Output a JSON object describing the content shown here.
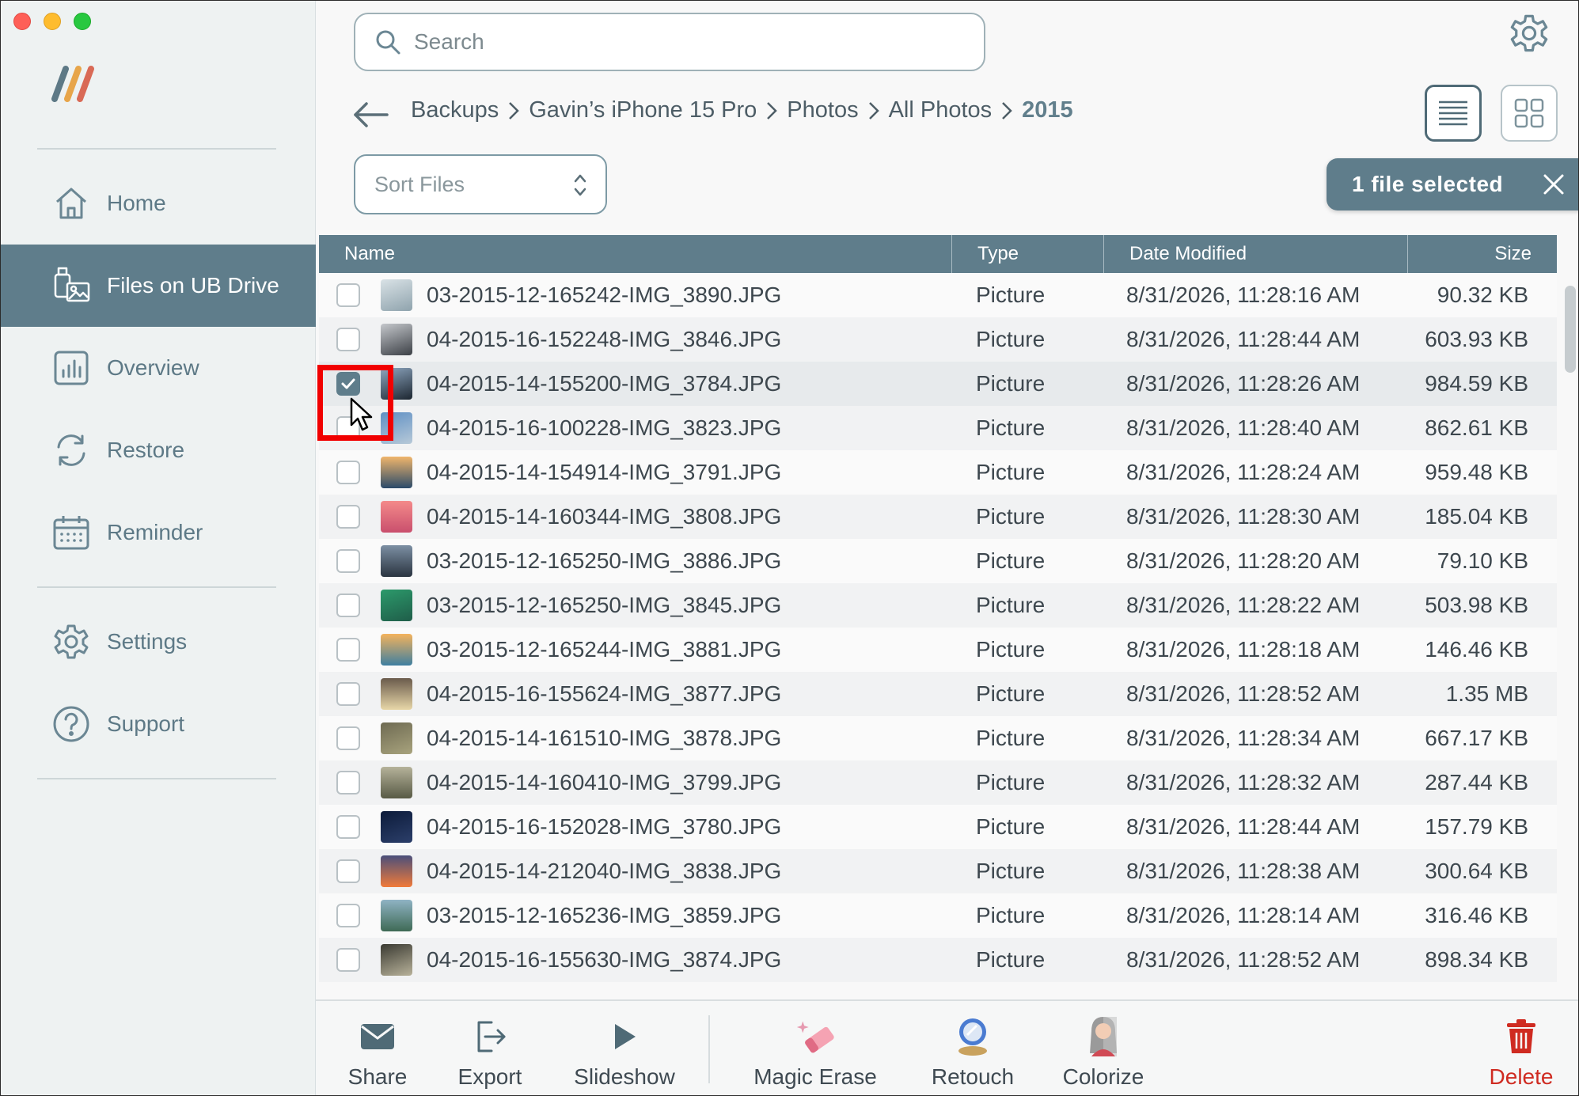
{
  "window": {
    "title": ""
  },
  "sidebar": {
    "items": [
      {
        "label": "Home",
        "icon": "home-icon"
      },
      {
        "label": "Files on UB Drive",
        "icon": "usb-photo-icon",
        "active": true
      },
      {
        "label": "Overview",
        "icon": "bar-chart-icon"
      },
      {
        "label": "Restore",
        "icon": "restore-icon"
      },
      {
        "label": "Reminder",
        "icon": "calendar-icon"
      },
      {
        "label": "Settings",
        "icon": "gear-icon"
      },
      {
        "label": "Support",
        "icon": "question-icon"
      }
    ]
  },
  "search": {
    "placeholder": "Search"
  },
  "breadcrumb": [
    "Backups",
    "Gavin’s iPhone 15 Pro",
    "Photos",
    "All Photos",
    "2015"
  ],
  "sort": {
    "label": "Sort Files"
  },
  "selection": {
    "label": "1 file selected"
  },
  "table": {
    "columns": [
      "Name",
      "Type",
      "Date Modified",
      "Size"
    ],
    "rows": [
      {
        "name": "03-2015-12-165242-IMG_3890.JPG",
        "type": "Picture",
        "date": "8/31/2026, 11:28:16 AM",
        "size": "90.32 KB",
        "checked": false
      },
      {
        "name": "04-2015-16-152248-IMG_3846.JPG",
        "type": "Picture",
        "date": "8/31/2026, 11:28:44 AM",
        "size": "603.93 KB",
        "checked": false
      },
      {
        "name": "04-2015-14-155200-IMG_3784.JPG",
        "type": "Picture",
        "date": "8/31/2026, 11:28:26 AM",
        "size": "984.59 KB",
        "checked": true
      },
      {
        "name": "04-2015-16-100228-IMG_3823.JPG",
        "type": "Picture",
        "date": "8/31/2026, 11:28:40 AM",
        "size": "862.61 KB",
        "checked": false
      },
      {
        "name": "04-2015-14-154914-IMG_3791.JPG",
        "type": "Picture",
        "date": "8/31/2026, 11:28:24 AM",
        "size": "959.48 KB",
        "checked": false
      },
      {
        "name": "04-2015-14-160344-IMG_3808.JPG",
        "type": "Picture",
        "date": "8/31/2026, 11:28:30 AM",
        "size": "185.04 KB",
        "checked": false
      },
      {
        "name": "03-2015-12-165250-IMG_3886.JPG",
        "type": "Picture",
        "date": "8/31/2026, 11:28:20 AM",
        "size": "79.10 KB",
        "checked": false
      },
      {
        "name": "03-2015-12-165250-IMG_3845.JPG",
        "type": "Picture",
        "date": "8/31/2026, 11:28:22 AM",
        "size": "503.98 KB",
        "checked": false
      },
      {
        "name": "03-2015-12-165244-IMG_3881.JPG",
        "type": "Picture",
        "date": "8/31/2026, 11:28:18 AM",
        "size": "146.46 KB",
        "checked": false
      },
      {
        "name": "04-2015-16-155624-IMG_3877.JPG",
        "type": "Picture",
        "date": "8/31/2026, 11:28:52 AM",
        "size": "1.35 MB",
        "checked": false
      },
      {
        "name": "04-2015-14-161510-IMG_3878.JPG",
        "type": "Picture",
        "date": "8/31/2026, 11:28:34 AM",
        "size": "667.17 KB",
        "checked": false
      },
      {
        "name": "04-2015-14-160410-IMG_3799.JPG",
        "type": "Picture",
        "date": "8/31/2026, 11:28:32 AM",
        "size": "287.44 KB",
        "checked": false
      },
      {
        "name": "04-2015-16-152028-IMG_3780.JPG",
        "type": "Picture",
        "date": "8/31/2026, 11:28:44 AM",
        "size": "157.79 KB",
        "checked": false
      },
      {
        "name": "04-2015-14-212040-IMG_3838.JPG",
        "type": "Picture",
        "date": "8/31/2026, 11:28:38 AM",
        "size": "300.64 KB",
        "checked": false
      },
      {
        "name": "03-2015-12-165236-IMG_3859.JPG",
        "type": "Picture",
        "date": "8/31/2026, 11:28:14 AM",
        "size": "316.46 KB",
        "checked": false
      },
      {
        "name": "04-2015-16-155630-IMG_3874.JPG",
        "type": "Picture",
        "date": "8/31/2026, 11:28:52 AM",
        "size": "898.34 KB",
        "checked": false
      }
    ]
  },
  "toolbar": {
    "share": "Share",
    "export": "Export",
    "slideshow": "Slideshow",
    "magic_erase": "Magic Erase",
    "retouch": "Retouch",
    "colorize": "Colorize",
    "delete": "Delete"
  },
  "colors": {
    "accent": "#5f7d8b",
    "sidebar_bg": "#eef2f2",
    "delete": "#cf2b21",
    "highlight_box": "#f10000"
  }
}
